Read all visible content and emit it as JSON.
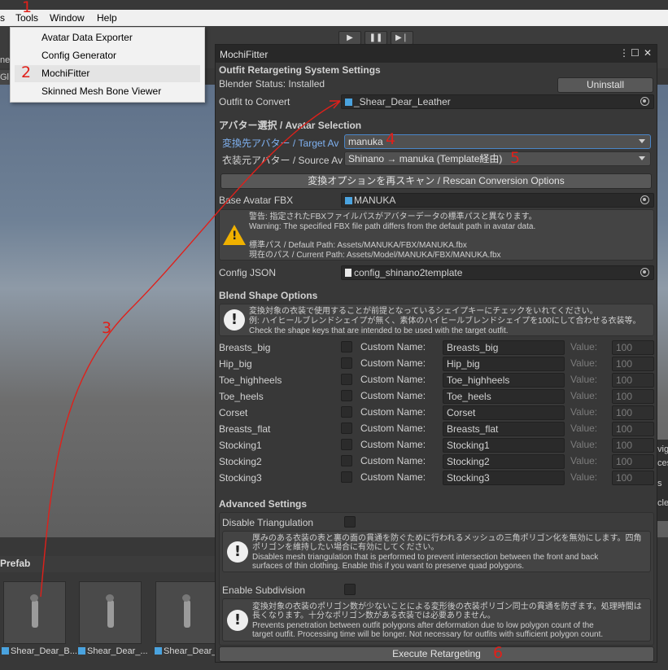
{
  "menubar": {
    "items": [
      "s",
      "Tools",
      "Window",
      "Help"
    ]
  },
  "tools_menu": {
    "items": [
      "Avatar Data Exporter",
      "Config Generator",
      "MochiFitter",
      "Skinned Mesh Bone Viewer"
    ]
  },
  "background": {
    "left_tab_1": "ne",
    "left_tab_2": "Gl",
    "right_texts": [
      "vig",
      "ces",
      "s",
      "cle"
    ]
  },
  "project": {
    "label": "Prefab",
    "thumbs": [
      "Shear_Dear_B...",
      "Shear_Dear_...",
      "Shear_Dear_..."
    ]
  },
  "window": {
    "title": "MochiFitter",
    "settings_header": "Outfit Retargeting System Settings",
    "blender_status": "Blender Status: Installed",
    "uninstall_label": "Uninstall",
    "outfit_label": "Outfit to Convert",
    "outfit_value": "_Shear_Dear_Leather",
    "avatar_header": "アバター選択 / Avatar Selection",
    "target_label": "変換先アバター / Target Av",
    "target_value": "manuka",
    "source_label": "衣装元アバター / Source Av",
    "source_value": "Shinano → manuka (Template経由)",
    "rescan_label": "変換オプションを再スキャン / Rescan Conversion Options",
    "base_fbx_label": "Base Avatar FBX",
    "base_fbx_value": "MANUKA",
    "warning_lines": [
      "警告: 指定されたFBXファイルパスがアバターデータの標準パスと異なります。",
      "Warning: The specified FBX file path differs from the default path in avatar data.",
      "標準パス / Default Path: Assets/MANUKA/FBX/MANUKA.fbx",
      "現在のパス / Current Path: Assets/Model/MANUKA/FBX/MANUKA.fbx"
    ],
    "config_label": "Config JSON",
    "config_value": "config_shinano2template",
    "blend_header": "Blend Shape Options",
    "blend_help_lines": [
      "変換対象の衣装で使用することが前提となっているシェイプキーにチェックをいれてください。",
      "例: ハイヒールブレンドシェイプが無く、素体のハイヒールブレンドシェイプを100にして合わせる衣装等。",
      "Check the shape keys that are intended to be used with the target outfit."
    ],
    "custom_name_label": "Custom Name:",
    "value_label": "Value:",
    "blend_rows": [
      {
        "name": "Breasts_big",
        "custom": "Breasts_big",
        "value": "100"
      },
      {
        "name": "Hip_big",
        "custom": "Hip_big",
        "value": "100"
      },
      {
        "name": "Toe_highheels",
        "custom": "Toe_highheels",
        "value": "100"
      },
      {
        "name": "Toe_heels",
        "custom": "Toe_heels",
        "value": "100"
      },
      {
        "name": "Corset",
        "custom": "Corset",
        "value": "100"
      },
      {
        "name": "Breasts_flat",
        "custom": "Breasts_flat",
        "value": "100"
      },
      {
        "name": "Stocking1",
        "custom": "Stocking1",
        "value": "100"
      },
      {
        "name": "Stocking2",
        "custom": "Stocking2",
        "value": "100"
      },
      {
        "name": "Stocking3",
        "custom": "Stocking3",
        "value": "100"
      }
    ],
    "advanced_header": "Advanced Settings",
    "disable_tri_label": "Disable Triangulation",
    "disable_tri_lines": [
      "厚みのある衣装の表と裏の面の貫通を防ぐために行われるメッシュの三角ポリゴン化を無効にします。四角",
      "ポリゴンを維持したい場合に有効にしてください。",
      "Disables mesh triangulation that is performed to prevent intersection between the front and back",
      "surfaces of thin clothing. Enable this if you want to preserve quad polygons."
    ],
    "subdiv_label": "Enable Subdivision",
    "subdiv_lines": [
      "変換対象の衣装のポリゴン数が少ないことによる変形後の衣装ポリゴン同士の貫通を防ぎます。処理時間は",
      "長くなります。十分なポリゴン数がある衣装では必要ありません。",
      "Prevents penetration between outfit polygons after deformation due to low polygon count of the",
      "target outfit. Processing time will be longer. Not necessary for outfits with sufficient polygon count."
    ],
    "execute_label": "Execute Retargeting"
  },
  "annotations": [
    "1",
    "2",
    "3",
    "4",
    "5",
    "6"
  ]
}
